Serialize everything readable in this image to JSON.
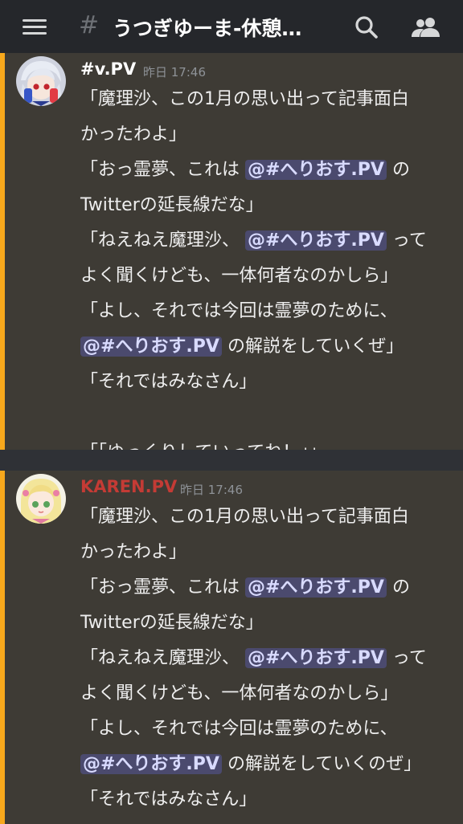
{
  "header": {
    "channel_name": "うつぎゆーま-休憩…"
  },
  "messages": [
    {
      "author": "#v.PV",
      "author_color": "#ffffff",
      "timestamp": "昨日 17:46",
      "lines": [
        {
          "pre": "「魔理沙、この1月の思い出って記事面白",
          "mention": "",
          "post": ""
        },
        {
          "pre": "かったわよ」",
          "mention": "",
          "post": ""
        },
        {
          "pre": "「おっ霊夢、これは ",
          "mention": "@#へりおす.PV",
          "post": " の"
        },
        {
          "pre": "Twitterの延長線だな」",
          "mention": "",
          "post": ""
        },
        {
          "pre": "「ねえねえ魔理沙、 ",
          "mention": "@#へりおす.PV",
          "post": " って"
        },
        {
          "pre": "よく聞くけども、一体何者なのかしら」",
          "mention": "",
          "post": ""
        },
        {
          "pre": "「よし、それでは今回は霊夢のために、",
          "mention": "",
          "post": ""
        },
        {
          "pre": "",
          "mention": "@#へりおす.PV",
          "post": " の解説をしていくぜ」"
        },
        {
          "pre": "「それではみなさん」",
          "mention": "",
          "post": ""
        },
        {
          "pre": "",
          "mention": "",
          "post": ""
        },
        {
          "pre": "「「ゆっくりしていってね！」」",
          "mention": "",
          "post": ""
        }
      ]
    },
    {
      "author": "KAREN.PV",
      "author_color": "#c43b35",
      "timestamp": "昨日 17:46",
      "lines": [
        {
          "pre": "「魔理沙、この1月の思い出って記事面白",
          "mention": "",
          "post": ""
        },
        {
          "pre": "かったわよ」",
          "mention": "",
          "post": ""
        },
        {
          "pre": "「おっ霊夢、これは ",
          "mention": "@#へりおす.PV",
          "post": " の"
        },
        {
          "pre": "Twitterの延長線だな」",
          "mention": "",
          "post": ""
        },
        {
          "pre": "「ねえねえ魔理沙、 ",
          "mention": "@#へりおす.PV",
          "post": " って"
        },
        {
          "pre": "よく聞くけども、一体何者なのかしら」",
          "mention": "",
          "post": ""
        },
        {
          "pre": "「よし、それでは今回は霊夢のために、",
          "mention": "",
          "post": ""
        },
        {
          "pre": "",
          "mention": "@#へりおす.PV",
          "post": " の解説をしていくのぜ」"
        },
        {
          "pre": "「それではみなさん」",
          "mention": "",
          "post": ""
        }
      ]
    }
  ],
  "colors": {
    "accent_bar": "#f7a81c",
    "mention_bg": "#4b4a6e"
  }
}
